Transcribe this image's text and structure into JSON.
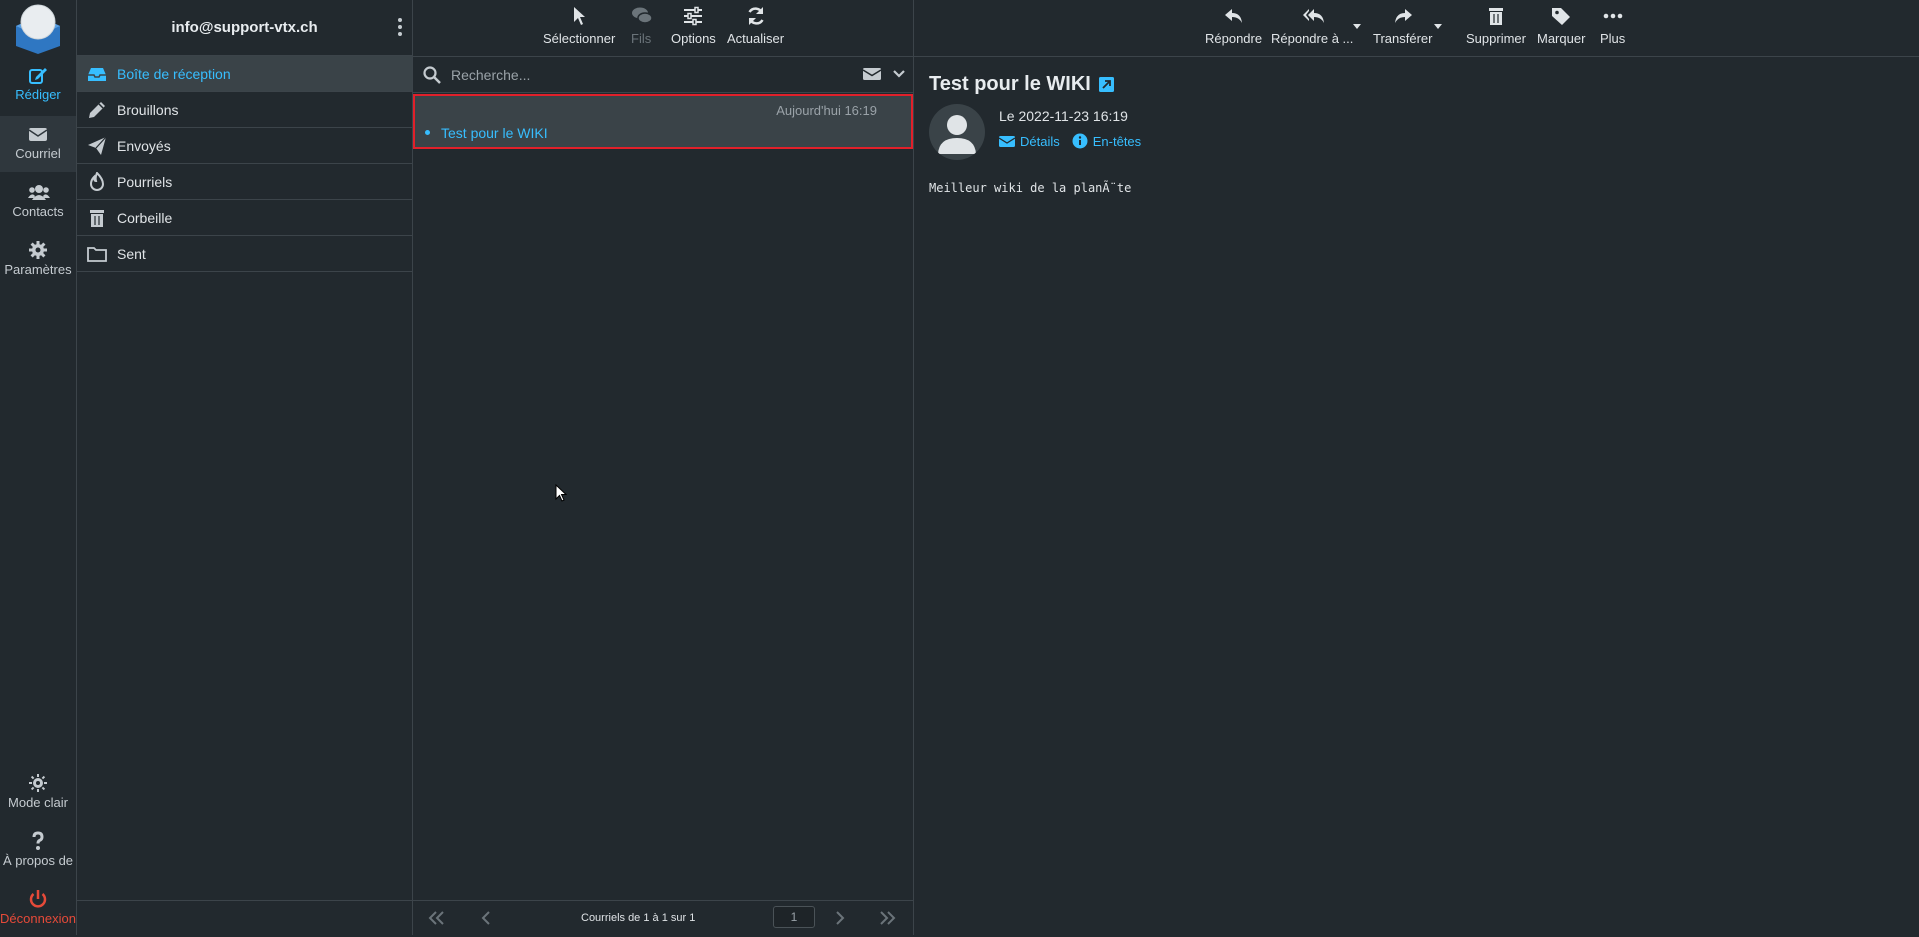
{
  "nav": {
    "compose": "Rédiger",
    "mail": "Courriel",
    "contacts": "Contacts",
    "settings": "Paramètres",
    "light_mode": "Mode clair",
    "about": "À propos de",
    "logout": "Déconnexion"
  },
  "account": {
    "email": "info@support-vtx.ch"
  },
  "folders": [
    {
      "label": "Boîte de réception",
      "icon": "inbox-icon",
      "active": true
    },
    {
      "label": "Brouillons",
      "icon": "pencil-icon"
    },
    {
      "label": "Envoyés",
      "icon": "paper-plane-icon"
    },
    {
      "label": "Pourriels",
      "icon": "fire-icon"
    },
    {
      "label": "Corbeille",
      "icon": "trash-icon"
    },
    {
      "label": "Sent",
      "icon": "folder-icon"
    }
  ],
  "list_toolbar": {
    "select": "Sélectionner",
    "threads": "Fils",
    "options": "Options",
    "refresh": "Actualiser"
  },
  "search": {
    "placeholder": "Recherche..."
  },
  "messages": [
    {
      "date": "Aujourd'hui 16:19",
      "subject": "Test pour le WIKI",
      "unread": true,
      "selected": true
    }
  ],
  "pager": {
    "count": "Courriels de 1 à 1 sur 1",
    "page": "1"
  },
  "message_toolbar": {
    "reply": "Répondre",
    "reply_all": "Répondre à ...",
    "forward": "Transférer",
    "delete": "Supprimer",
    "mark": "Marquer",
    "more": "Plus"
  },
  "message": {
    "subject": "Test pour le WIKI",
    "date": "Le 2022-11-23 16:19",
    "details": "Détails",
    "headers": "En-têtes",
    "body": "Meilleur wiki de la planÃ¨te"
  },
  "colors": {
    "accent": "#37beff",
    "logout": "#e64a39",
    "selection_border": "#e1202a",
    "background": "#22292e"
  }
}
